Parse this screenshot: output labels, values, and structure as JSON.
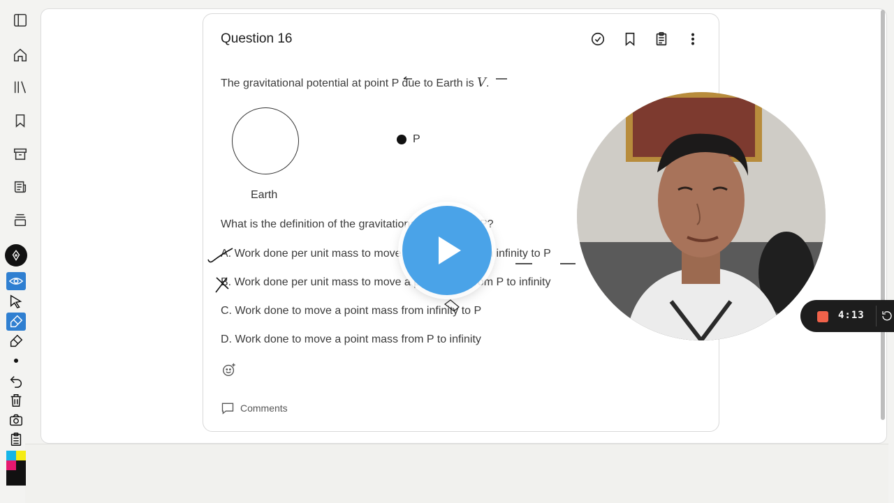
{
  "question": {
    "title": "Question 16",
    "statement_prefix": "The gravitational potential at point P due to Earth is ",
    "statement_var": "V",
    "statement_suffix": ".",
    "diagram": {
      "earth_label": "Earth",
      "point_label": "P"
    },
    "prompt": "What is the definition of the gravitational potential at P?",
    "options": [
      "A. Work done per unit mass to move a point mass from infinity to P",
      "B. Work done per unit mass to move a point mass from P to infinity",
      "C. Work done to move a point mass from infinity to P",
      "D. Work done to move a point mass from P to infinity"
    ],
    "comments_label": "Comments",
    "action_icons": [
      "check-circle-icon",
      "bookmark-icon",
      "clipboard-icon",
      "more-vertical-icon"
    ]
  },
  "nav_icons": [
    "sidebar-toggle-icon",
    "home-icon",
    "library-icon",
    "bookmark-icon",
    "archive-icon",
    "newspaper-icon",
    "stack-icon"
  ],
  "annotation_tools": [
    "eye-icon",
    "pointer-icon",
    "highlighter-icon",
    "eraser-icon",
    "dot-brush-icon",
    "undo-icon",
    "trash-icon",
    "camera-icon",
    "clipboard-icon"
  ],
  "swatch_colors": [
    "#15b5e8",
    "#f5ec14",
    "#e5186e",
    "#111111"
  ],
  "recording": {
    "time": "4:13",
    "stop_color": "#f0624a"
  },
  "colors": {
    "play_button": "#4aa3e8",
    "active_tool": "#2f7fd1"
  }
}
